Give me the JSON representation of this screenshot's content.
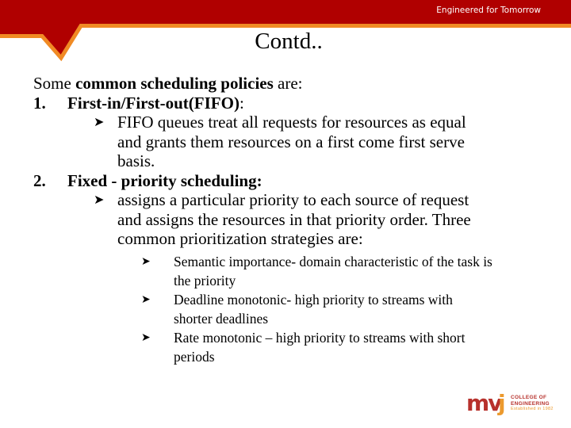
{
  "header": {
    "tagline": "Engineered for Tomorrow",
    "colors": {
      "band": "#b00000",
      "accent": "#f08a24"
    }
  },
  "slide": {
    "title": "Contd..",
    "intro": {
      "plain_start": "Some ",
      "bold": "common scheduling policies",
      "plain_end": " are:"
    },
    "items": [
      {
        "number": "1.",
        "heading_bold": "First-in/First-out(FIFO)",
        "heading_tail": ":",
        "bullets": [
          {
            "lines": [
              "FIFO queues treat all requests for resources as equal",
              "and grants them resources on a first come first serve",
              "basis."
            ]
          }
        ]
      },
      {
        "number": "2.",
        "heading_bold": "Fixed - priority scheduling:",
        "heading_tail": "",
        "bullets": [
          {
            "lines": [
              "assigns a particular priority to each source of request",
              "and assigns the resources in that priority order. Three",
              "common prioritization strategies are:"
            ],
            "sub_bullets": [
              {
                "lines": [
                  "Semantic importance- domain characteristic of the task is",
                  "the priority"
                ]
              },
              {
                "lines": [
                  "Deadline monotonic- high priority to streams with",
                  "shorter deadlines"
                ]
              },
              {
                "lines": [
                  "Rate monotonic – high priority to streams with short",
                  "periods"
                ]
              }
            ]
          }
        ]
      }
    ],
    "bullet_icon": "arrow-bullet-icon",
    "bullet_glyph": "➤"
  },
  "logo": {
    "mark_mv": "mv",
    "mark_j": "j",
    "line1": "COLLEGE OF",
    "line2": "ENGINEERING",
    "line3": "Established in 1982",
    "colors": {
      "primary": "#b7312c",
      "secondary": "#ec9a2e"
    }
  }
}
